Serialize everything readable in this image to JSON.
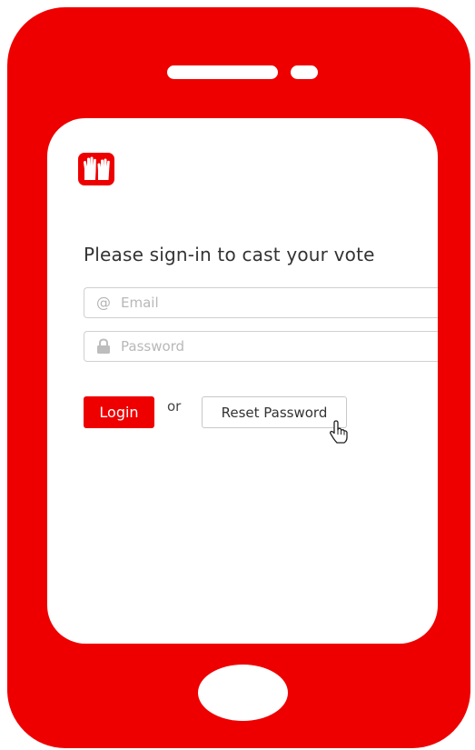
{
  "theme": {
    "brand_color": "#ee0000",
    "screen_color": "#ffffff"
  },
  "app": {
    "logo_icon": "raised-hands-icon"
  },
  "signin": {
    "title": "Please sign-in to cast your vote",
    "email": {
      "icon": "at-sign-icon",
      "placeholder": "Email",
      "value": ""
    },
    "password": {
      "icon": "lock-icon",
      "placeholder": "Password",
      "value": ""
    },
    "login_label": "Login",
    "or_text": "or",
    "reset_label": "Reset Password"
  },
  "pointer": {
    "icon": "hand-pointer-cursor-icon",
    "over": "Reset Password"
  }
}
